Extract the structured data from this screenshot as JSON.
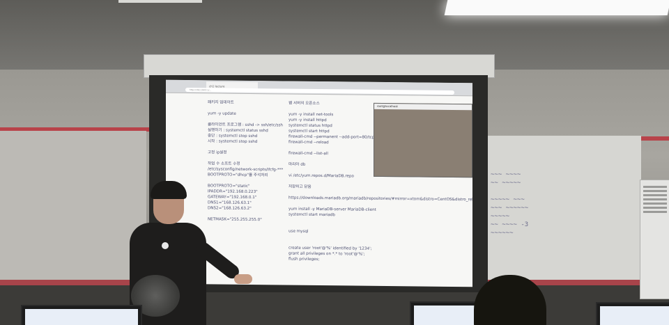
{
  "browser": {
    "tab_label": "ch1 lecture",
    "url_text": "http://192.168.0.1/..."
  },
  "slide": {
    "left_column": [
      "패키지 업데이트",
      "",
      "yum -y update",
      "",
      "클라이언트 프로그램 : sshd -> ssh/etc/ssh",
      "실행하기 : systemctl status sshd",
      "중단 : systemctl stop sshd",
      "시작 : systemctl stop sshd",
      "",
      "고정 ip설정",
      "",
      "작업 수 소프트 수정",
      "/etc/sysconfig/network-scripts/ifcfg-***",
      "BOOTPROTO=\"dhcp\"를 주석처리",
      "",
      "BOOTPROTO=\"static\"",
      "IPADDR=\"192.168.0.223\"",
      "GATEWAY=\"192.168.0.1\"",
      "DNS1=\"168.126.63.1\"",
      "DNS2=\"168.126.63.2\"",
      "",
      "NETMASK=\"255.255.255.0\""
    ],
    "right_column": [
      "웹 서버의 오픈소스",
      "",
      "yum -y install net-tools",
      "yum -y install httpd",
      "systemctl status httpd",
      "systemctl start httpd",
      "firewall-cmd --permanent --add-port=80/tcp",
      "firewall-cmd --reload",
      "",
      "firewall-cmd --list-all",
      "",
      "마리아 db",
      "",
      "vi /etc/yum.repos.d/MariaDB.repo",
      "",
      "저장하고 닫음",
      "",
      "https://downloads.mariadb.org/mariadb/repositories/#mirror=xtom&distro=CentOS&distro_release=centos7-amd64--centos7&version=10.1",
      "",
      "yum install -y MariaDB-server MariaDB-client",
      "systemctl start mariadb",
      "",
      "",
      "use mysql",
      "",
      "",
      "create user 'root'@'%' identified by '1234';",
      "grant all privileges on *.* to 'root'@'%';",
      "flush privileges;"
    ],
    "terminal_title": "root@localhost"
  },
  "colors": {
    "slide_text": "#4b4e70",
    "wall_stripe": "#b8434a",
    "terminal_bg": "#8a7f73"
  }
}
